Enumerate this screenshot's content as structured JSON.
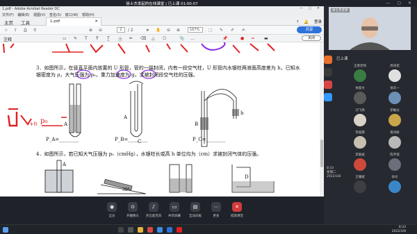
{
  "meeting": {
    "title": "徐士杰发起的在线课堂 | 已上课 01:00:07"
  },
  "acrobat": {
    "window_title": "1.pdf - Adobe Acrobat Reader DC",
    "menus": [
      "文件(F)",
      "编辑(E)",
      "视图(V)",
      "签名(S)",
      "窗口(W)",
      "帮助(H)"
    ],
    "tabs": {
      "home": "主页",
      "tools": "工具",
      "doc": "1.pdf",
      "login": "登录"
    },
    "page_current": "2",
    "page_total": "/ 2",
    "zoom": "167%",
    "share_label": "共享",
    "annot_label": "注释",
    "close_label": "关闭"
  },
  "content": {
    "q3": "3．如图所示，在竖直平面内放置的 U 形管，管的一端封闭，内有一段空气柱，U 形管内水银柱两液面高度差为 h，已知水银密度为 ρ，大气压强为 p₀，重力加速度为 g，求被封闭段空气柱的压强。",
    "q4": "4．如图所示，若已知大气压强为 p₀（cmHg），水银柱长或高 h 单位均为（cm）求被封闭气体的压强。",
    "pa": "P_A=",
    "pb": "P_B=",
    "pc": "P_C=",
    "pd": "P_D=",
    "angle": "30°"
  },
  "meeting_bottom": {
    "buttons": [
      "全员",
      "开摄像头",
      "开启麦克风",
      "共享屏幕",
      "互动白板",
      "更多",
      "结束课堂"
    ]
  },
  "sidebar": {
    "teacher_name": "徐士杰老师",
    "online_label": "已上课",
    "students": [
      {
        "name": "王者老师",
        "color": "#3a7d44"
      },
      {
        "name": "周涛诺",
        "color": "#e0e0e0"
      },
      {
        "name": "徐俊文",
        "color": "#5a5a5a"
      },
      {
        "name": "徐天一",
        "color": "#6b8fb5"
      },
      {
        "name": "刘飞燕",
        "color": "#d8d2c8"
      },
      {
        "name": "李敏仪",
        "color": "#c9a64a"
      },
      {
        "name": "李俊霖",
        "color": "#c7c0b0"
      },
      {
        "name": "蒋诗妍",
        "color": "#b8b8b8"
      },
      {
        "name": "李家斌",
        "color": "#d04a3c"
      },
      {
        "name": "陈宇琪",
        "color": "#6a6f7a"
      },
      {
        "name": "王耀斌",
        "color": "#3d3f45"
      },
      {
        "name": "徐文",
        "color": "#3b86c6"
      }
    ],
    "side_clock_time": "8:33",
    "side_clock_day": "星期二",
    "side_clock_date": "2022/3/8"
  },
  "taskbar": {
    "time": "8:33",
    "date": "2022/3/8"
  },
  "colors": {
    "annotation_red": "#e02020",
    "annotation_purple": "#8a2be2",
    "accent_blue": "#2d72d9"
  }
}
